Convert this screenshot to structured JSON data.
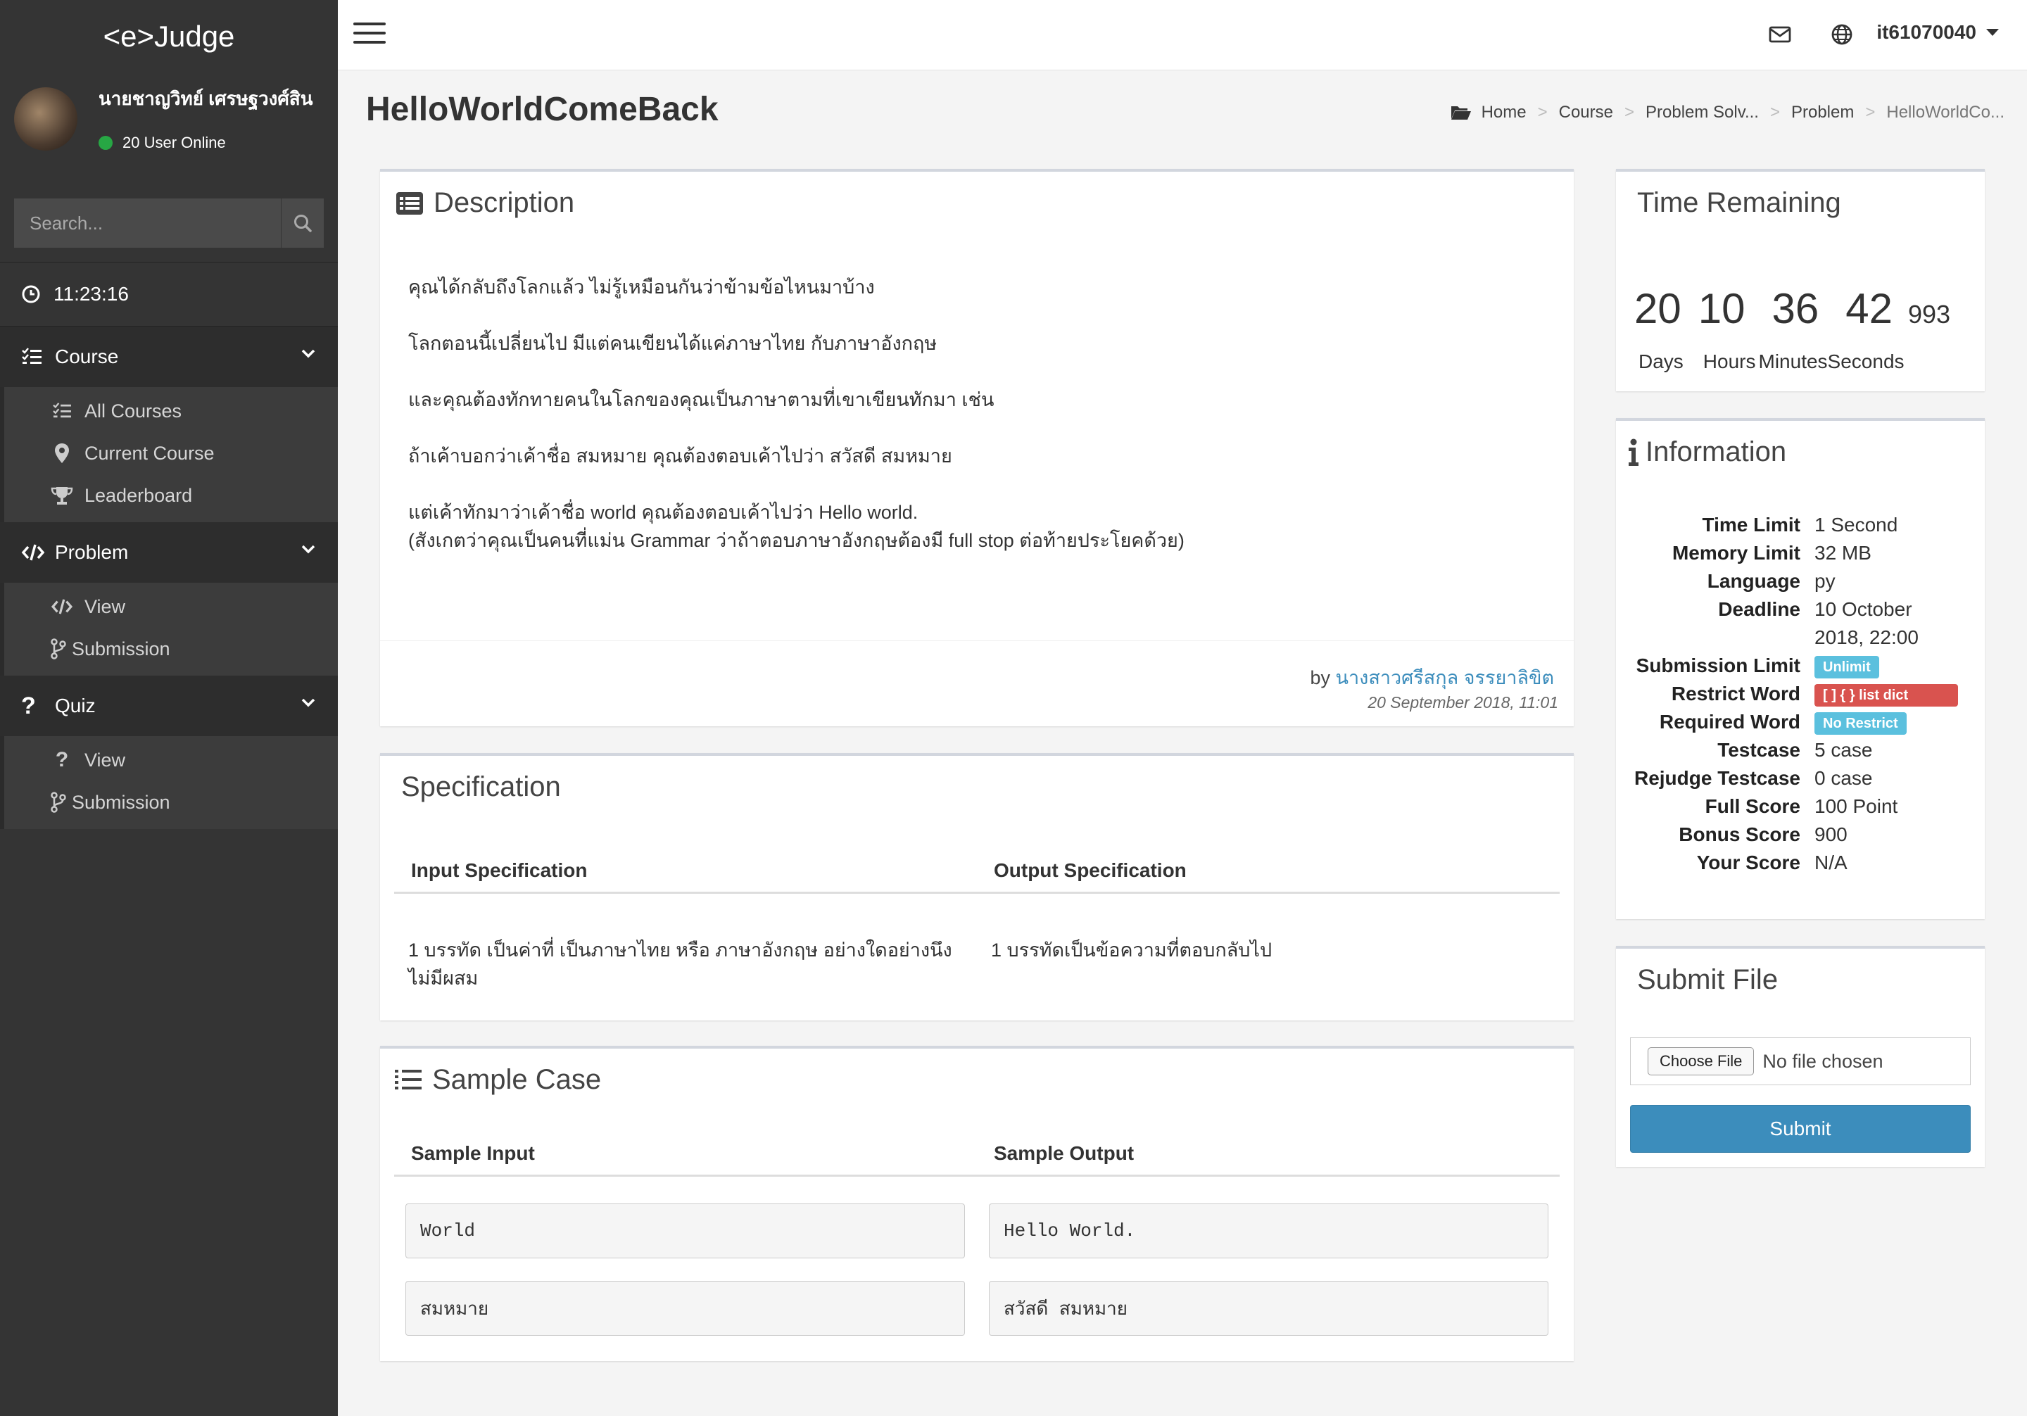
{
  "app": {
    "brand": "<e>Judge"
  },
  "user": {
    "name": "นายชาญวิทย์ เศรษฐวงศ์สิน",
    "online": "20 User Online"
  },
  "search": {
    "placeholder": "Search..."
  },
  "sidebar": {
    "clock": "11:23:16",
    "course": {
      "label": "Course",
      "items": [
        "All Courses",
        "Current Course",
        "Leaderboard"
      ]
    },
    "problem": {
      "label": "Problem",
      "items": [
        "View",
        "Submission"
      ]
    },
    "quiz": {
      "label": "Quiz",
      "items": [
        "View",
        "Submission"
      ]
    }
  },
  "topbar": {
    "username": "it61070040"
  },
  "page": {
    "title": "HelloWorldComeBack",
    "breadcrumb": [
      "Home",
      "Course",
      "Problem Solv...",
      "Problem",
      "HelloWorldCo..."
    ]
  },
  "description": {
    "title": "Description",
    "paragraphs": [
      "คุณได้กลับถึงโลกแล้ว ไม่รู้เหมือนกันว่าข้ามข้อไหนมาบ้าง",
      "โลกตอนนี้เปลี่ยนไป มีแต่คนเขียนได้แค่ภาษาไทย กับภาษาอังกฤษ",
      "และคุณต้องทักทายคนในโลกของคุณเป็นภาษาตามที่เขาเขียนทักมา เช่น",
      "ถ้าเค้าบอกว่าเค้าชื่อ สมหมาย คุณต้องตอบเค้าไปว่า สวัสดี สมหมาย",
      "แต่เค้าทักมาว่าเค้าชื่อ world คุณต้องตอบเค้าไปว่า Hello world.",
      "(สังเกตว่าคุณเป็นคนที่แม่น Grammar ว่าถ้าตอบภาษาอังกฤษต้องมี full stop ต่อท้ายประโยคด้วย)"
    ],
    "by_label": "by",
    "author": "นางสาวศรีสกุล จรรยาลิขิต",
    "date": "20 September 2018, 11:01"
  },
  "specification": {
    "title": "Specification",
    "input_header": "Input Specification",
    "output_header": "Output Specification",
    "input_text": "1 บรรทัด เป็นค่าที่ เป็นภาษาไทย หรือ ภาษาอังกฤษ อย่างใดอย่างนึง ไม่มีผสม",
    "output_text": "1 บรรทัดเป็นข้อความที่ตอบกลับไป"
  },
  "samples": {
    "title": "Sample Case",
    "input_header": "Sample Input",
    "output_header": "Sample Output",
    "rows": [
      {
        "input": "World",
        "output": "Hello World."
      },
      {
        "input": "สมหมาย",
        "output": "สวัสดี สมหมาย"
      }
    ]
  },
  "timer": {
    "title": "Time Remaining",
    "days": "20",
    "hours": "10",
    "minutes": "36",
    "seconds": "42",
    "ms": "993",
    "labels": {
      "days": "Days",
      "hours": "Hours",
      "minutes": "Minutes",
      "seconds": "Seconds"
    }
  },
  "information": {
    "title": "Information",
    "rows": [
      {
        "label": "Time Limit",
        "value": "1 Second"
      },
      {
        "label": "Memory Limit",
        "value": "32 MB"
      },
      {
        "label": "Language",
        "value": "py"
      },
      {
        "label": "Deadline",
        "value": "10 October"
      },
      {
        "label": "",
        "value": "2018, 22:00"
      }
    ],
    "submission_limit": {
      "label": "Submission Limit",
      "badge": "Unlimit"
    },
    "restrict_word": {
      "label": "Restrict Word",
      "badge": "[ ] { } list dict"
    },
    "required_word": {
      "label": "Required Word",
      "badge": "No Restrict"
    },
    "rows2": [
      {
        "label": "Testcase",
        "value": "5 case"
      },
      {
        "label": "Rejudge Testcase",
        "value": "0 case"
      },
      {
        "label": "Full Score",
        "value": "100 Point"
      },
      {
        "label": "Bonus Score",
        "value": "900"
      },
      {
        "label": "Your Score",
        "value": "N/A"
      }
    ]
  },
  "submit": {
    "title": "Submit File",
    "choose_label": "Choose File",
    "no_file": "No file chosen",
    "button": "Submit"
  },
  "colors": {
    "accent": "#3c8dbc",
    "sidebar": "#343434",
    "info_badge": "#5bc0de",
    "danger_badge": "#d9534f",
    "online": "#27a744"
  }
}
